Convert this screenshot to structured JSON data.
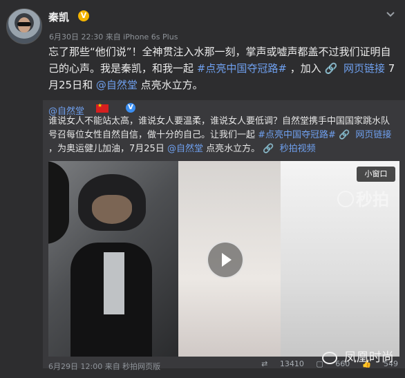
{
  "author": {
    "name": "秦凯",
    "badge": "V"
  },
  "post": {
    "meta": "6月30日 22:30 来自 iPhone 6s Plus",
    "text_1": "忘了那些“他们说”！全神贯注入水那一刻，掌声或嘘声都盖不过我们证明自己的心声。我是秦凯，和我一起",
    "hashtag": "#点亮中国夺冠路#",
    "text_2": "，加入",
    "link_text": "网页链接",
    "text_3": " 7月25日和",
    "mention": "@自然堂",
    "text_4": " 点亮水立方。"
  },
  "repost": {
    "user": "@自然堂",
    "badge": "V",
    "text_1": "谁说女人不能站太高，谁说女人要温柔，谁说女人要低调？自然堂携手中国国家跳水队号召每位女性自然自信，做十分的自己。让我们一起",
    "hashtag": "#点亮中国夺冠路#",
    "link_text": "网页链接",
    "text_2": "，为奥运健儿加油，7月25日",
    "mention": "@自然堂",
    "text_3": " 点亮水立方。",
    "video_link": "秒拍视频",
    "video_badge": "小窗口",
    "video_logo": "秒拍",
    "meta": "6月29日 12:00 来自 秒拍网页版",
    "stats": {
      "reposts": "13410",
      "comments": "660",
      "likes": "549"
    }
  },
  "watermark": "凤凰时尚",
  "icons": {
    "verified": "verified-icon",
    "chevron": "chevron-down-icon",
    "link": "link-icon",
    "play": "play-icon",
    "repost": "repost-icon",
    "comment": "comment-icon",
    "like": "like-icon",
    "logo": "wechat-icon"
  },
  "colors": {
    "accent": "#6fa0ef",
    "badge_orange": "#f4b400",
    "background": "#2d2d2f"
  }
}
